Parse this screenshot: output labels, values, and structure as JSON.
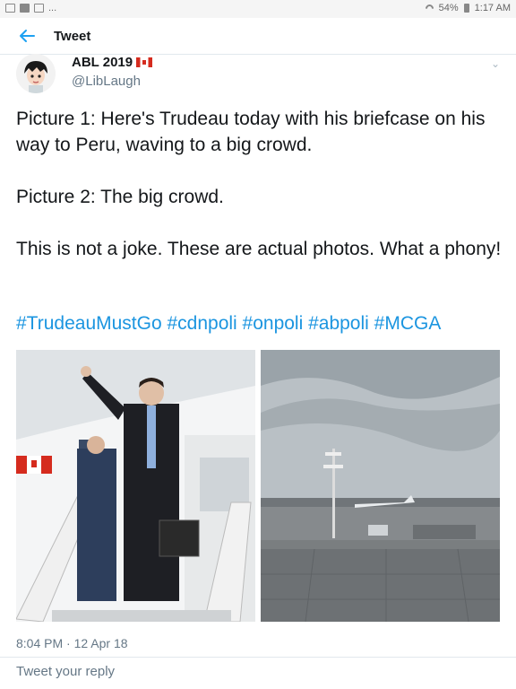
{
  "status_bar": {
    "battery": "54%",
    "time": "1:17 AM",
    "notifications": "..."
  },
  "header": {
    "title": "Tweet"
  },
  "tweet": {
    "author_name": "ABL 2019",
    "handle": "@LibLaugh",
    "paragraphs": [
      "Picture 1: Here's Trudeau today with his briefcase on his way to Peru, waving to a big crowd.",
      "Picture 2: The big crowd.",
      "This is not a joke. These are actual photos. What a phony!"
    ],
    "hashtags": "#TrudeauMustGo #cdnpoli #onpoli #abpoli #MCGA",
    "timestamp": "8:04 PM · 12 Apr 18"
  },
  "reply": {
    "placeholder": "Tweet your reply"
  },
  "colors": {
    "link": "#1b95e0",
    "muted": "#657786",
    "text": "#14171a"
  }
}
